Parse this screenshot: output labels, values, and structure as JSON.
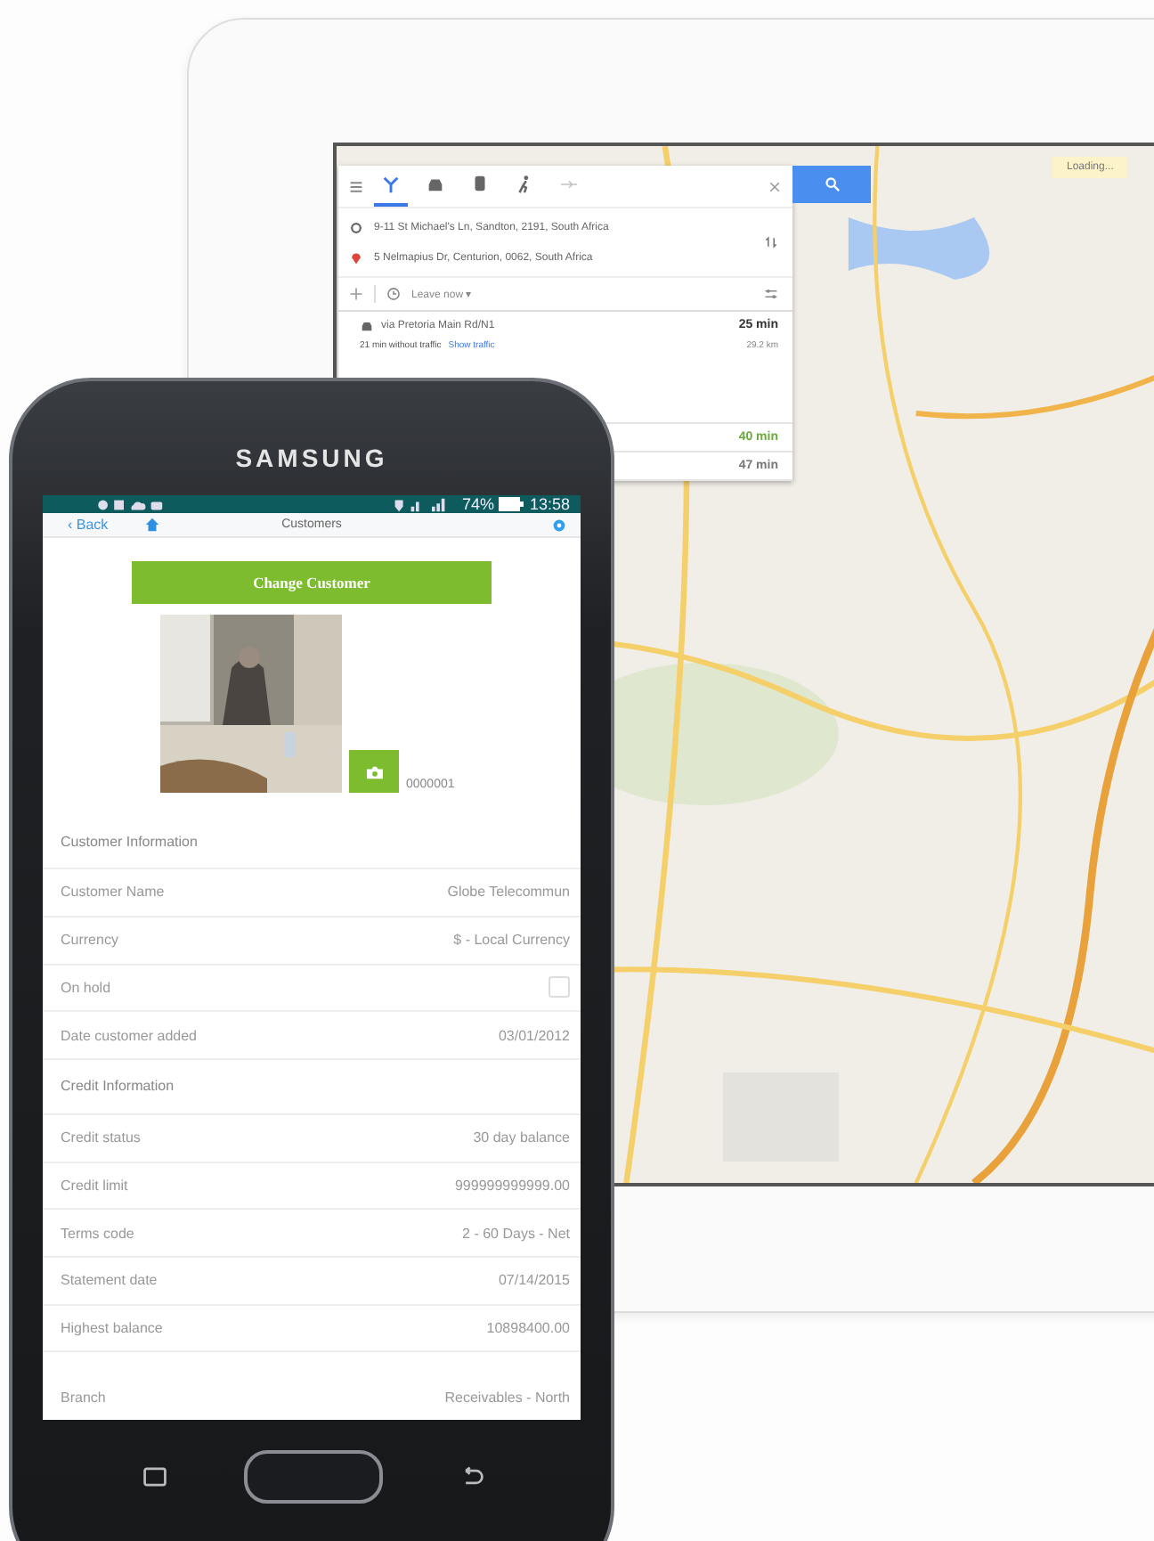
{
  "tablet": {
    "loading_badge": "Loading...",
    "directions": {
      "modes": [
        {
          "kind": "best",
          "selected": true
        },
        {
          "kind": "car",
          "selected": false
        },
        {
          "kind": "transit",
          "selected": false
        },
        {
          "kind": "walk",
          "selected": false
        },
        {
          "kind": "flight",
          "selected": false
        }
      ],
      "origin": "9-11 St Michael's Ln, Sandton, 2191, South Africa",
      "destination": "5 Nelmapius Dr, Centurion, 0062, South Africa",
      "depart": "Leave now ▾",
      "routes": [
        {
          "via": "via Pretoria Main Rd/N1",
          "duration": "25 min",
          "note": "21 min without traffic",
          "link": "Show traffic",
          "distance": "29.2 km",
          "color": "#333333"
        },
        {
          "duration": "40 min",
          "color": "#6aaa3a"
        },
        {
          "duration": "47 min",
          "color": "#777777"
        }
      ]
    }
  },
  "phone": {
    "brand": "SAMSUNG",
    "status": {
      "battery": "74%",
      "time": "13:58"
    },
    "header": {
      "back": "‹ Back",
      "title": "Customers"
    },
    "action_button": "Change Customer",
    "customer_number": "0000001",
    "rows": [
      {
        "kind": "section",
        "label": "Customer Information"
      },
      {
        "kind": "field",
        "label": "Customer Name",
        "value": "Globe Telecommun"
      },
      {
        "kind": "field",
        "label": "Currency",
        "value": "$ - Local Currency"
      },
      {
        "kind": "checkbox",
        "label": "On hold",
        "checked": false
      },
      {
        "kind": "field",
        "label": "Date customer added",
        "value": "03/01/2012"
      },
      {
        "kind": "section",
        "label": "Credit Information"
      },
      {
        "kind": "field",
        "label": "Credit status",
        "value": "30 day balance"
      },
      {
        "kind": "field",
        "label": "Credit limit",
        "value": "999999999999.00"
      },
      {
        "kind": "field",
        "label": "Terms code",
        "value": "2 - 60 Days - Net"
      },
      {
        "kind": "field",
        "label": "Statement date",
        "value": "07/14/2015"
      },
      {
        "kind": "field",
        "label": "Highest balance",
        "value": "10898400.00"
      },
      {
        "kind": "field",
        "label": "Branch",
        "value": "Receivables - North"
      }
    ]
  }
}
